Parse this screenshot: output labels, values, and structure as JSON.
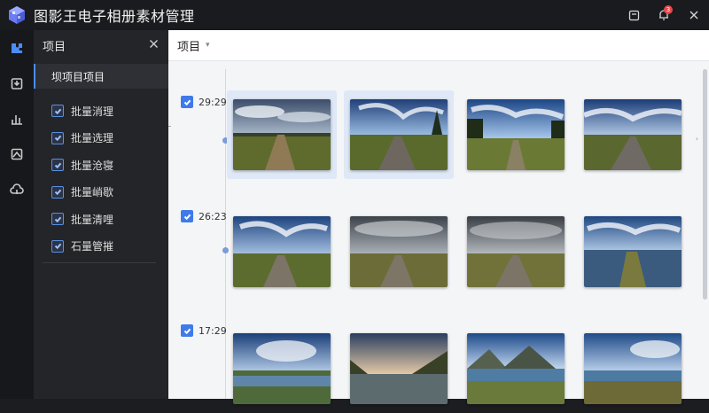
{
  "app": {
    "title": "图影王电子相册素材管理",
    "accent": "#4b8df8",
    "notification_count": "3"
  },
  "rail": {
    "items": [
      {
        "name": "puzzle-icon",
        "active": true
      },
      {
        "name": "import-icon",
        "active": false
      },
      {
        "name": "stats-icon",
        "active": false
      },
      {
        "name": "image-edit-icon",
        "active": false
      },
      {
        "name": "cloud-icon",
        "active": false
      }
    ]
  },
  "panel": {
    "title": "项目",
    "selected_item": "坝项目项目",
    "items": [
      {
        "label": "批量消理",
        "checked": true
      },
      {
        "label": "批量选理",
        "checked": true
      },
      {
        "label": "批量沧寝",
        "checked": true
      },
      {
        "label": "批量峭歇",
        "checked": true
      },
      {
        "label": "批量清哩",
        "checked": true
      },
      {
        "label": "石量管摧",
        "checked": true
      }
    ]
  },
  "main": {
    "header_title": "项目",
    "groups": [
      {
        "label": "29:29",
        "checked": true
      },
      {
        "label": "26:23",
        "checked": true
      },
      {
        "label": "17:29",
        "checked": true
      }
    ]
  }
}
